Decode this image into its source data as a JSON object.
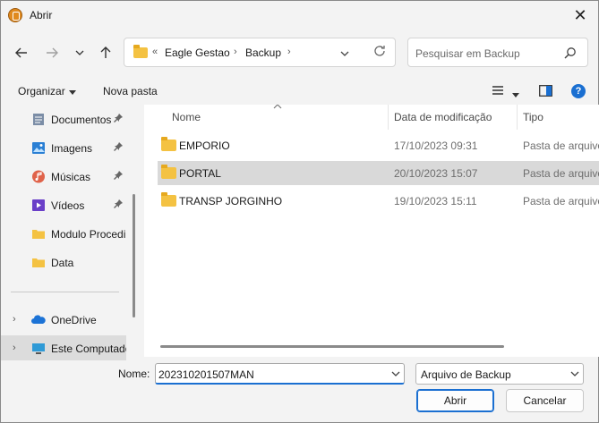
{
  "window": {
    "title": "Abrir",
    "close_glyph": "✕"
  },
  "nav": {
    "back_icon": "arrow-left-icon",
    "forward_icon": "arrow-right-icon",
    "recent_icon": "chevron-down-icon",
    "up_icon": "arrow-up-icon"
  },
  "address": {
    "overflow": "«",
    "crumbs": [
      "Eagle Gestao",
      "Backup"
    ],
    "separator": "›"
  },
  "search": {
    "placeholder": "Pesquisar em Backup"
  },
  "toolbar": {
    "organize": "Organizar",
    "new_folder": "Nova pasta"
  },
  "sidebar": {
    "items": [
      {
        "label": "Documentos",
        "icon": "documents-icon",
        "pinned": true
      },
      {
        "label": "Imagens",
        "icon": "images-icon",
        "pinned": true
      },
      {
        "label": "Músicas",
        "icon": "music-icon",
        "pinned": true
      },
      {
        "label": "Vídeos",
        "icon": "videos-icon",
        "pinned": true
      },
      {
        "label": "Modulo Procedi",
        "icon": "folder-icon",
        "pinned": false
      },
      {
        "label": "Data",
        "icon": "folder-icon",
        "pinned": false
      },
      {
        "label": "OneDrive",
        "icon": "onedrive-icon",
        "pinned": false
      },
      {
        "label": "Este Computador",
        "icon": "computer-icon",
        "pinned": false
      }
    ],
    "pin_glyph": "📌",
    "expand_glyph": "›"
  },
  "columns": {
    "name": "Nome",
    "date": "Data de modificação",
    "type": "Tipo"
  },
  "files": [
    {
      "name": "EMPORIO",
      "date": "17/10/2023 09:31",
      "type": "Pasta de arquivos"
    },
    {
      "name": "PORTAL",
      "date": "20/10/2023 15:07",
      "type": "Pasta de arquivos"
    },
    {
      "name": "TRANSP JORGINHO",
      "date": "19/10/2023 15:11",
      "type": "Pasta de arquivos"
    }
  ],
  "footer": {
    "name_label": "Nome:",
    "file_name": "202310201507MAN",
    "file_type": "Arquivo de Backup",
    "open_label": "Abrir",
    "cancel_label": "Cancelar"
  },
  "colors": {
    "accent": "#1a6fd1",
    "folder": "#f4c242",
    "selected_row": "#d9d9d9"
  }
}
